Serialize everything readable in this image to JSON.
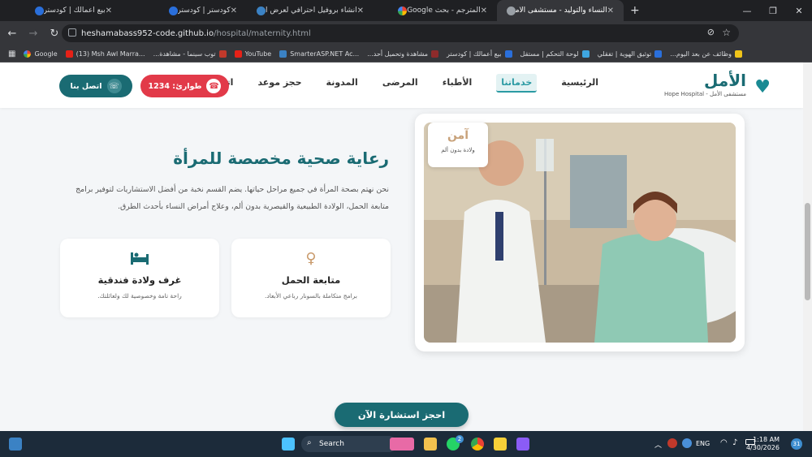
{
  "browser": {
    "tabs": [
      {
        "title": "بيع أعمالك | كودستر",
        "active": false
      },
      {
        "title": "كودستر | كودستر",
        "active": false
      },
      {
        "title": "انشاء بروفيل احترافي لعرض الحد...",
        "active": false
      },
      {
        "title": "المترجم - بحث Google",
        "active": false
      },
      {
        "title": "النساء والتوليد - مستشفى الأمل",
        "active": true
      }
    ],
    "new_tab": "+",
    "url_host": "heshamabass952-code.github.io",
    "url_path": "/hospital/maternity.html",
    "bookmarks": [
      "Google",
      "(13) Msh Awl Marra...",
      "توب سينما - مشاهدة...",
      "YouTube",
      "SmarterASP.NET Ac...",
      "مشاهدة وتحميل أحد...",
      "بيع أعمالك | كودستر",
      "لوحة التحكم | مستقل",
      "توثيق الهوية | تفقلي",
      "وظائف عن بعد اليوم..."
    ]
  },
  "header": {
    "logo_name": "الأمل",
    "logo_sub": "مستشفى الأمل - Hope Hospital",
    "nav": [
      "الرئيسية",
      "خدماتنا",
      "الأطباء",
      "المرضى",
      "المدونة",
      "حجز موعد",
      "اتصل بنا"
    ],
    "nav_active_index": 1,
    "emergency_label": "طوارئ: 1234",
    "contact_label": "اتصل بنا"
  },
  "main": {
    "title": "رعاية صحية مخصصة للمرأة",
    "description": "نحن نهتم بصحة المرأة في جميع مراحل حياتها. يضم القسم نخبة من أفضل الاستشاريات لتوفير برامج متابعة الحمل، الولادة الطبيعية والقيصرية بدون ألم، وعلاج أمراض النساء بأحدث الطرق.",
    "cards": [
      {
        "icon": "pregnant-woman-icon",
        "title": "متابعة الحمل",
        "subtitle": "برامج متكاملة بالسونار رباعي الأبعاد."
      },
      {
        "icon": "bed-icon",
        "title": "غرف ولادة فندقية",
        "subtitle": "راحة تامة وخصوصية لك ولعائلتك."
      }
    ],
    "badge_title": "آمن",
    "badge_sub": "ولادة بدون ألم",
    "cta": "احجز استشارة الآن"
  },
  "taskbar": {
    "search": "Search",
    "lang": "ENG",
    "time": "1:18 AM",
    "date": "4/30/2026",
    "notifications": "31",
    "whatsapp_badge": "2"
  },
  "colors": {
    "primary": "#1a6b73",
    "accent": "#2b9aa3",
    "emergency": "#e23a49",
    "gold": "#c8a27a"
  }
}
